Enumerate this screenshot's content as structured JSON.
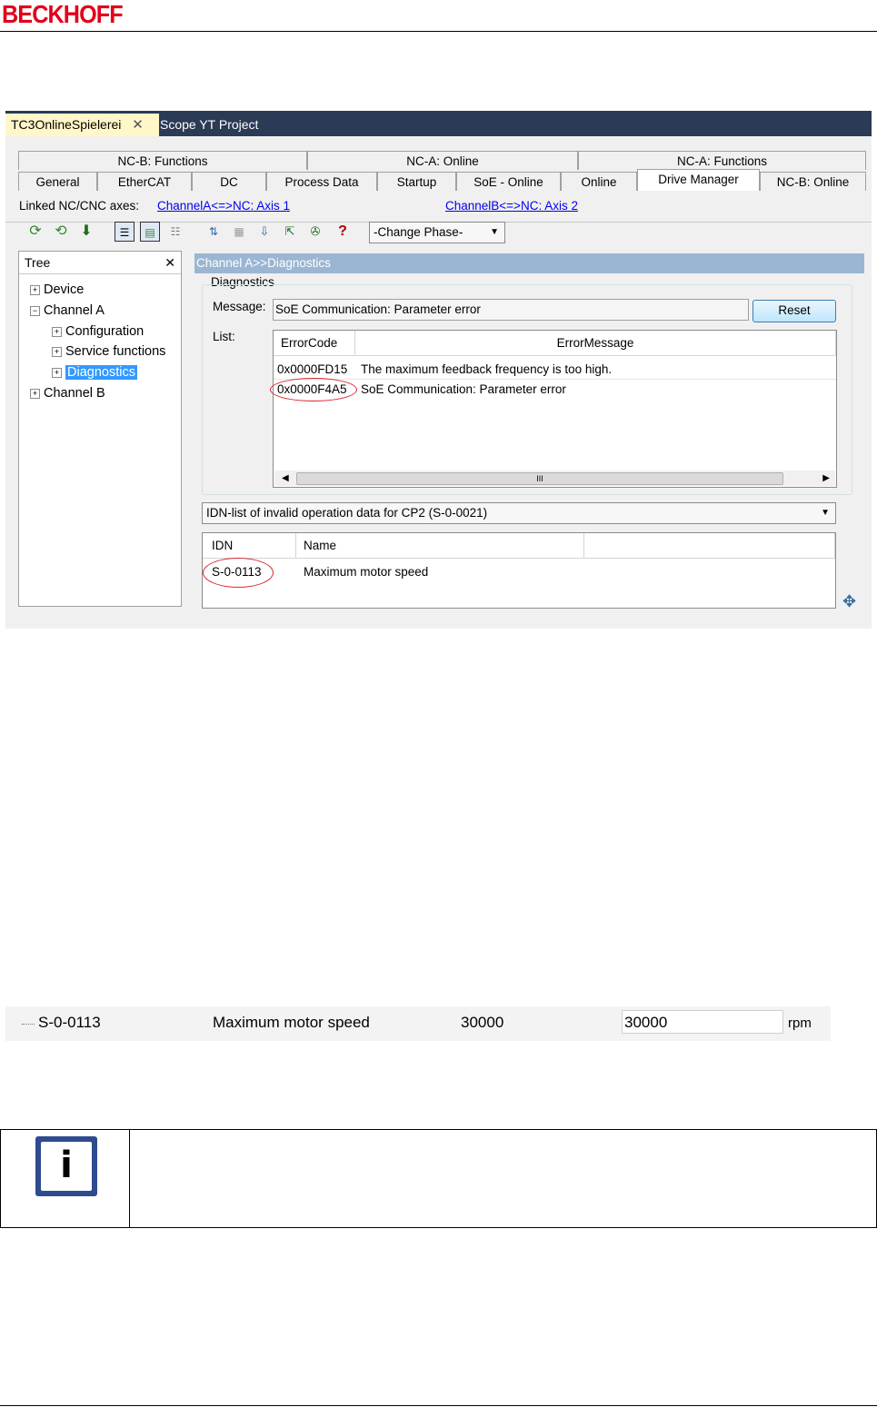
{
  "header": {
    "brand": "BECKHOFF"
  },
  "ide": {
    "doc_tabs": {
      "active": "TC3OnlineSpielerei",
      "close": "✕",
      "inactive": "Scope YT Project"
    },
    "tabs_top": [
      "NC-B: Functions",
      "NC-A: Online",
      "NC-A: Functions"
    ],
    "tabs_bottom": [
      "General",
      "EtherCAT",
      "DC",
      "Process Data",
      "Startup",
      "SoE - Online",
      "Online",
      "Drive Manager",
      "NC-B: Online"
    ],
    "active_tab": "Drive Manager",
    "linked_label": "Linked NC/CNC axes:",
    "link_a": "ChannelA<=>NC: Axis 1",
    "link_b": "ChannelB<=>NC: Axis 2",
    "phase_combo": "-Change Phase-",
    "tree": {
      "title": "Tree",
      "close": "✕",
      "nodes": [
        "Device",
        "Channel A",
        "Configuration",
        "Service functions",
        "Diagnostics",
        "Channel B"
      ]
    },
    "panel_title": "Channel A>>Diagnostics",
    "diagnostics": {
      "group_label": "Diagnostics",
      "message_label": "Message:",
      "message_value": "SoE Communication: Parameter error",
      "reset_label": "Reset",
      "list_label": "List:",
      "columns": [
        "ErrorCode",
        "ErrorMessage"
      ],
      "rows": [
        {
          "code": "0x0000FD15",
          "message": "The maximum feedback frequency is too high."
        },
        {
          "code": "0x0000F4A5",
          "message": "SoE Communication: Parameter error"
        }
      ],
      "scroll_grip": "III"
    },
    "idn_combo": "IDN-list of invalid operation data for CP2 (S-0-0021)",
    "idn_list": {
      "columns": [
        "IDN",
        "Name"
      ],
      "rows": [
        {
          "idn": "S-0-0113",
          "name": "Maximum motor speed"
        }
      ]
    }
  },
  "param_row": {
    "idn": "S-0-0113",
    "name": "Maximum motor speed",
    "value": "30000",
    "edit_value": "30000",
    "unit": "rpm"
  },
  "note": {
    "icon": "i"
  },
  "colors": {
    "brand_red": "#e2001a",
    "highlight_red": "#d8262d",
    "selection_blue": "#3399ff",
    "doc_tab_bg": "#2b3a55"
  }
}
